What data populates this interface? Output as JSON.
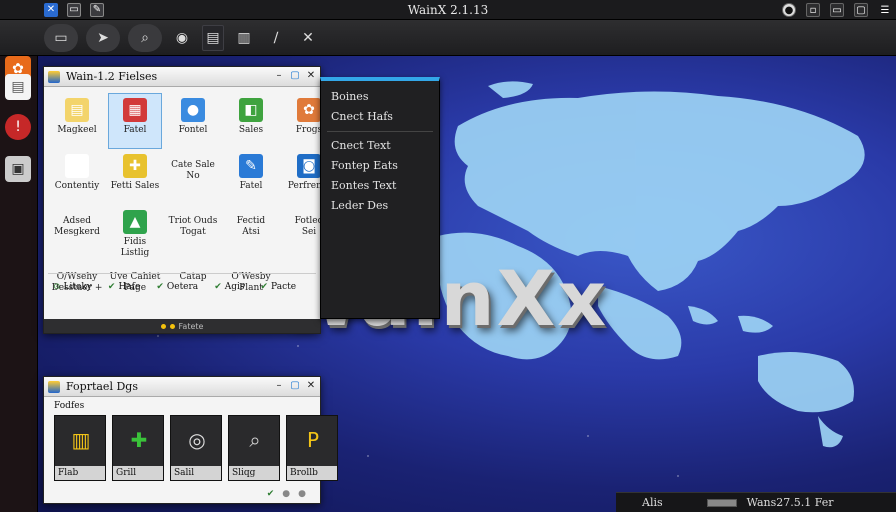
{
  "topbar": {
    "title": "WainX 2.1.13",
    "left_icons": [
      "app-logo-icon",
      "folder-icon",
      "document-icon"
    ],
    "right_icons": [
      "settings-icon",
      "window-icon",
      "restore-icon",
      "maximize-icon",
      "menu-icon"
    ]
  },
  "toolbar": {
    "tools": [
      "archive-icon",
      "compass-icon",
      "search-icon",
      "circle-icon",
      "notes-icon",
      "list-icon",
      "pen-icon",
      "tools-icon"
    ]
  },
  "dock": {
    "apps": [
      "photos-app-icon",
      "text-editor-icon",
      "alert-app-icon",
      "terminal-icon"
    ]
  },
  "file_window": {
    "title": "Wain-1.2 Fielses",
    "items": [
      {
        "label": "Magkeel",
        "icon": "text-file-icon",
        "color": "#f3d46b",
        "glyph": "▤"
      },
      {
        "label": "Fatel",
        "icon": "grid-app-icon",
        "color": "#d23a3a",
        "glyph": "▦",
        "selected": true
      },
      {
        "label": "Fontel",
        "icon": "chat-bubble-icon",
        "color": "#3a8be0",
        "glyph": "●"
      },
      {
        "label": "Sales",
        "icon": "green-book-icon",
        "color": "#3fa33f",
        "glyph": "◧"
      },
      {
        "label": "Frogs",
        "icon": "paint-icon",
        "color": "#e07a3a",
        "glyph": "✿"
      },
      {
        "label": "Contentiy",
        "icon": "phone-icon",
        "color": "#ffffff",
        "glyph": "✆"
      },
      {
        "label": "Fetti Sales",
        "icon": "puzzle-icon",
        "color": "#e8c22e",
        "glyph": "✚"
      },
      {
        "label": "Cate Sale\nNo",
        "icon": "blank-icon",
        "color": "transparent",
        "glyph": ""
      },
      {
        "label": "Fatel",
        "icon": "pencil-icon",
        "color": "#2a7ad6",
        "glyph": "✎"
      },
      {
        "label": "Perfrents",
        "icon": "camera-app-icon",
        "color": "#1f6dc6",
        "glyph": "◙"
      },
      {
        "label": "Adsed\nMesgkerd",
        "icon": "blank-icon",
        "color": "transparent",
        "glyph": ""
      },
      {
        "label": "Fidis\nListlig",
        "icon": "picture-icon",
        "color": "#2fa34c",
        "glyph": "▲"
      },
      {
        "label": "Triot Ouds\nTogat",
        "icon": "blank-icon",
        "color": "transparent",
        "glyph": ""
      },
      {
        "label": "Fectid\nAtsi",
        "icon": "blank-icon",
        "color": "transparent",
        "glyph": ""
      },
      {
        "label": "Fotled\nSei",
        "icon": "blank-icon",
        "color": "transparent",
        "glyph": ""
      },
      {
        "label": "O/Wsehy\nDesstaer +",
        "icon": "blank-icon",
        "color": "transparent",
        "glyph": ""
      },
      {
        "label": "Uve Cahiet\nPage",
        "icon": "blank-icon",
        "color": "transparent",
        "glyph": ""
      },
      {
        "label": "Catap",
        "icon": "blank-icon",
        "color": "transparent",
        "glyph": ""
      },
      {
        "label": "O'Wesby\nPlant",
        "icon": "blank-icon",
        "color": "transparent",
        "glyph": ""
      },
      {
        "label": "",
        "icon": "blank-icon",
        "color": "transparent",
        "glyph": ""
      }
    ],
    "bottom_items": [
      {
        "label": "Liteky",
        "check": "⊙"
      },
      {
        "label": "Hafe",
        "check": "✔"
      },
      {
        "label": "Oetera",
        "check": "✔"
      },
      {
        "label": "Agis",
        "check": "✔"
      },
      {
        "label": "Pacte",
        "check": "✔"
      }
    ],
    "status": "Fatete"
  },
  "context_menu": {
    "items_top": [
      "Boines",
      "Cnect Hafs"
    ],
    "items_bottom": [
      "Cnect Text",
      "Fontep Eats",
      "Eontes Text",
      "Leder Des"
    ]
  },
  "watermark": "WainXx",
  "second_window": {
    "title": "Foprtael Dgs",
    "section": "Fodfes",
    "tiles": [
      {
        "label": "Flab",
        "icon": "folders-icon",
        "color": "#f2c418",
        "glyph": "▥"
      },
      {
        "label": "Grill",
        "icon": "robot-icon",
        "color": "#3ac23a",
        "glyph": "✚"
      },
      {
        "label": "Salil",
        "icon": "lock-icon",
        "color": "#dcdcdc",
        "glyph": "◎"
      },
      {
        "label": "Sliqg",
        "icon": "magnifier-icon",
        "color": "#cfcfcf",
        "glyph": "⌕"
      },
      {
        "label": "Brollb",
        "icon": "p-badge-icon",
        "color": "#f2c418",
        "glyph": "P"
      }
    ]
  },
  "taskbar": {
    "left_label": "Alis",
    "right_label": "Wans27.5.1 Fer"
  }
}
